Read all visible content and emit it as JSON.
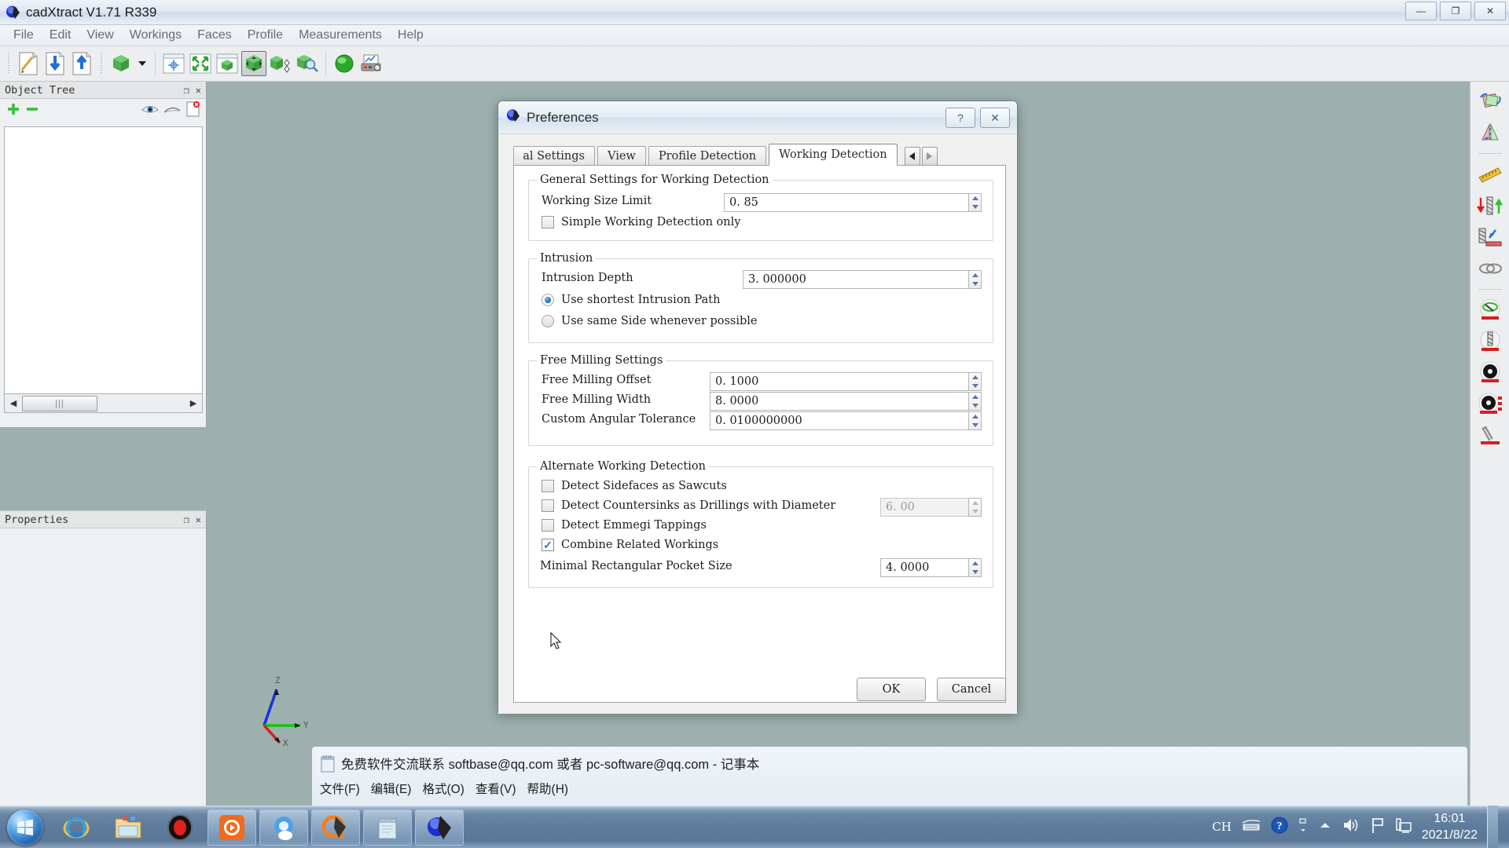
{
  "app": {
    "title": "cadXtract V1.71 R339",
    "window_buttons": [
      "minimize",
      "restore",
      "close"
    ],
    "menu": [
      "File",
      "Edit",
      "View",
      "Workings",
      "Faces",
      "Profile",
      "Measurements",
      "Help"
    ]
  },
  "docks": {
    "object_tree": {
      "title": "Object Tree",
      "buttons": [
        "float",
        "close"
      ]
    },
    "properties": {
      "title": "Properties",
      "buttons": [
        "float",
        "close"
      ]
    }
  },
  "viewport": {
    "axis": {
      "x": "X",
      "y": "Y",
      "z": "Z",
      "color_x": "#e01b1b",
      "color_y": "#13c413",
      "color_z": "#1432dc"
    },
    "background": "#9db0ae"
  },
  "dialog": {
    "title": "Preferences",
    "title_buttons": {
      "help": "?",
      "close": "✕"
    },
    "tabs": [
      {
        "label": "al Settings",
        "selected": false,
        "clipped": true
      },
      {
        "label": "View",
        "selected": false,
        "clipped": false
      },
      {
        "label": "Profile Detection",
        "selected": false,
        "clipped": false
      },
      {
        "label": "Working Detection",
        "selected": true,
        "clipped": false
      }
    ],
    "tab_scroll": {
      "left": "◀",
      "right": "▶"
    },
    "groups": [
      {
        "legend": "General Settings for Working Detection",
        "fields": [
          {
            "type": "spin",
            "label": "Working Size Limit",
            "value": "0. 85",
            "disabled": false
          },
          {
            "type": "checkbox",
            "label": "Simple Working Detection only",
            "checked": false
          }
        ]
      },
      {
        "legend": "Intrusion",
        "fields": [
          {
            "type": "spin",
            "label": "Intrusion Depth",
            "value": "3. 000000",
            "disabled": false
          },
          {
            "type": "radio",
            "label": "Use shortest Intrusion Path",
            "checked": true
          },
          {
            "type": "radio",
            "label": "Use same Side whenever possible",
            "checked": false
          }
        ]
      },
      {
        "legend": "Free Milling Settings",
        "fields": [
          {
            "type": "spin",
            "label": "Free Milling Offset",
            "value": "0. 1000",
            "disabled": false
          },
          {
            "type": "spin",
            "label": "Free Milling Width",
            "value": "8. 0000",
            "disabled": false
          },
          {
            "type": "spin",
            "label": "Custom Angular Tolerance",
            "value": "0. 0100000000",
            "disabled": false
          }
        ]
      },
      {
        "legend": "Alternate Working Detection",
        "fields": [
          {
            "type": "checkbox",
            "label": "Detect Sidefaces as Sawcuts",
            "checked": false
          },
          {
            "type": "checkbox-spin",
            "label": "Detect Countersinks as Drillings with Diameter",
            "checked": false,
            "value": "6. 00",
            "disabled": true
          },
          {
            "type": "checkbox",
            "label": "Detect Emmegi Tappings",
            "checked": false
          },
          {
            "type": "checkbox",
            "label": "Combine Related Workings",
            "checked": true
          },
          {
            "type": "spin",
            "label": "Minimal Rectangular Pocket Size",
            "value": "4. 0000",
            "disabled": false
          }
        ]
      }
    ],
    "buttons": {
      "ok": "OK",
      "cancel": "Cancel"
    }
  },
  "notepad": {
    "title": "免费软件交流联系 softbase@qq.com 或者 pc-software@qq.com - 记事本",
    "menu": [
      "文件(F)",
      "编辑(E)",
      "格式(O)",
      "查看(V)",
      "帮助(H)"
    ]
  },
  "taskbar": {
    "start": "start-orb",
    "tasks": [
      "internet-explorer",
      "file-explorer",
      "recorder",
      "media-player",
      "browser-q",
      "qq-app",
      "notepad",
      "cadxtract"
    ],
    "tray": {
      "ime": "CH",
      "icons": [
        "keyboard-icon",
        "help-icon",
        "overflow-icon",
        "show-hidden-icon",
        "volume-icon",
        "flag-icon",
        "network-icon"
      ],
      "time": "16:01",
      "date": "2021/8/22"
    }
  }
}
